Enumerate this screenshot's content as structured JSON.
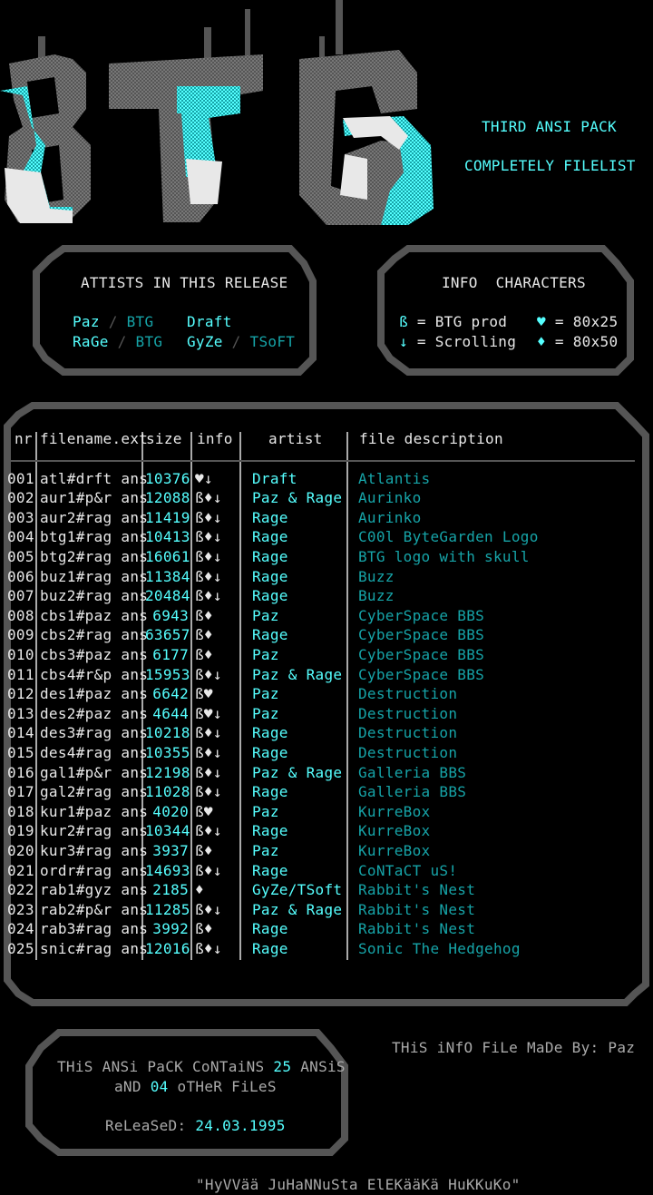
{
  "header": {
    "pack_title": "THIRD ANSI PACK",
    "pack_subtitle": "COMPLETELY FILELIST"
  },
  "artists_box": {
    "title": "ATTISTS IN THIS RELEASE",
    "entries": [
      {
        "name": "Paz",
        "group": "BTG"
      },
      {
        "name": "Draft",
        "group": ""
      },
      {
        "name": "RaGe",
        "group": "BTG"
      },
      {
        "name": "GyZe",
        "group": "TSoFT"
      }
    ]
  },
  "info_box": {
    "title": "INFO  CHARACTERS",
    "legend": [
      {
        "symbol": "ß",
        "text": "= BTG prod"
      },
      {
        "symbol": "♥",
        "text": "= 80x25"
      },
      {
        "symbol": "↓",
        "text": "= Scrolling"
      },
      {
        "symbol": "♦",
        "text": "= 80x50"
      }
    ]
  },
  "table": {
    "columns": [
      "nr",
      "filename.ext",
      "size",
      "info",
      "artist",
      "file description"
    ],
    "rows": [
      {
        "nr": "001",
        "file": "atl#drft ans",
        "size": "10376",
        "info": "♥↓",
        "artist": "Draft",
        "desc": "Atlantis"
      },
      {
        "nr": "002",
        "file": "aur1#p&r ans",
        "size": "12088",
        "info": "ß♦↓",
        "artist": "Paz & Rage",
        "desc": "Aurinko"
      },
      {
        "nr": "003",
        "file": "aur2#rag ans",
        "size": "11419",
        "info": "ß♦↓",
        "artist": "Rage",
        "desc": "Aurinko"
      },
      {
        "nr": "004",
        "file": "btg1#rag ans",
        "size": "10413",
        "info": "ß♦↓",
        "artist": "Rage",
        "desc": "C00l ByteGarden Logo"
      },
      {
        "nr": "005",
        "file": "btg2#rag ans",
        "size": "16061",
        "info": "ß♦↓",
        "artist": "Rage",
        "desc": "BTG logo with skull"
      },
      {
        "nr": "006",
        "file": "buz1#rag ans",
        "size": "11384",
        "info": "ß♦↓",
        "artist": "Rage",
        "desc": "Buzz"
      },
      {
        "nr": "007",
        "file": "buz2#rag ans",
        "size": "20484",
        "info": "ß♦↓",
        "artist": "Rage",
        "desc": "Buzz"
      },
      {
        "nr": "008",
        "file": "cbs1#paz ans",
        "size": "6943",
        "info": "ß♦",
        "artist": "Paz",
        "desc": "CyberSpace BBS"
      },
      {
        "nr": "009",
        "file": "cbs2#rag ans",
        "size": "63657",
        "info": "ß♦",
        "artist": "Rage",
        "desc": "CyberSpace BBS"
      },
      {
        "nr": "010",
        "file": "cbs3#paz ans",
        "size": "6177",
        "info": "ß♦",
        "artist": "Paz",
        "desc": "CyberSpace BBS"
      },
      {
        "nr": "011",
        "file": "cbs4#r&p ans",
        "size": "15953",
        "info": "ß♦↓",
        "artist": "Paz & Rage",
        "desc": "CyberSpace BBS"
      },
      {
        "nr": "012",
        "file": "des1#paz ans",
        "size": "6642",
        "info": "ß♥",
        "artist": "Paz",
        "desc": "Destruction"
      },
      {
        "nr": "013",
        "file": "des2#paz ans",
        "size": "4644",
        "info": "ß♥↓",
        "artist": "Paz",
        "desc": "Destruction"
      },
      {
        "nr": "014",
        "file": "des3#rag ans",
        "size": "10218",
        "info": "ß♦↓",
        "artist": "Rage",
        "desc": "Destruction"
      },
      {
        "nr": "015",
        "file": "des4#rag ans",
        "size": "10355",
        "info": "ß♦↓",
        "artist": "Rage",
        "desc": "Destruction"
      },
      {
        "nr": "016",
        "file": "gal1#p&r ans",
        "size": "12198",
        "info": "ß♦↓",
        "artist": "Paz & Rage",
        "desc": "Galleria BBS"
      },
      {
        "nr": "017",
        "file": "gal2#rag ans",
        "size": "11028",
        "info": "ß♦↓",
        "artist": "Rage",
        "desc": "Galleria BBS"
      },
      {
        "nr": "018",
        "file": "kur1#paz ans",
        "size": "4020",
        "info": "ß♥",
        "artist": "Paz",
        "desc": "KurreBox"
      },
      {
        "nr": "019",
        "file": "kur2#rag ans",
        "size": "10344",
        "info": "ß♦↓",
        "artist": "Rage",
        "desc": "KurreBox"
      },
      {
        "nr": "020",
        "file": "kur3#rag ans",
        "size": "3937",
        "info": "ß♦",
        "artist": "Paz",
        "desc": "KurreBox"
      },
      {
        "nr": "021",
        "file": "ordr#rag ans",
        "size": "14693",
        "info": "ß♦↓",
        "artist": "Rage",
        "desc": "CoNTaCT uS!"
      },
      {
        "nr": "022",
        "file": "rab1#gyz ans",
        "size": "2185",
        "info": "♦",
        "artist": "GyZe/TSoft",
        "desc": "Rabbit's Nest"
      },
      {
        "nr": "023",
        "file": "rab2#p&r ans",
        "size": "11285",
        "info": "ß♦↓",
        "artist": "Paz & Rage",
        "desc": "Rabbit's Nest"
      },
      {
        "nr": "024",
        "file": "rab3#rag ans",
        "size": "3992",
        "info": "ß♦",
        "artist": "Rage",
        "desc": "Rabbit's Nest"
      },
      {
        "nr": "025",
        "file": "snic#rag ans",
        "size": "12016",
        "info": "ß♦↓",
        "artist": "Rage",
        "desc": "Sonic The Hedgehog"
      }
    ]
  },
  "summary_box": {
    "line1_pre": "THiS ANSi PaCK CoNTaiNS ",
    "ansi_count": "25",
    "line1_post": " ANSiS",
    "line2_pre": "aND ",
    "other_count": "04",
    "line2_post": " oTHeR FiLeS",
    "released_label": "ReLeaSeD: ",
    "released_date": "24.03.1995"
  },
  "credit": "THiS iNfO FiLe MaDe By: Paz",
  "footer_quote": "\"HyVVää JuHaNNuSta ElEKääKä HuKKuKo\"",
  "colors": {
    "background": "#000000",
    "cyan": "#55ffff",
    "dark_cyan": "#16a4a8",
    "light_gray": "#aaaaaa",
    "dark_gray": "#555555",
    "white": "#e8e8e8"
  }
}
